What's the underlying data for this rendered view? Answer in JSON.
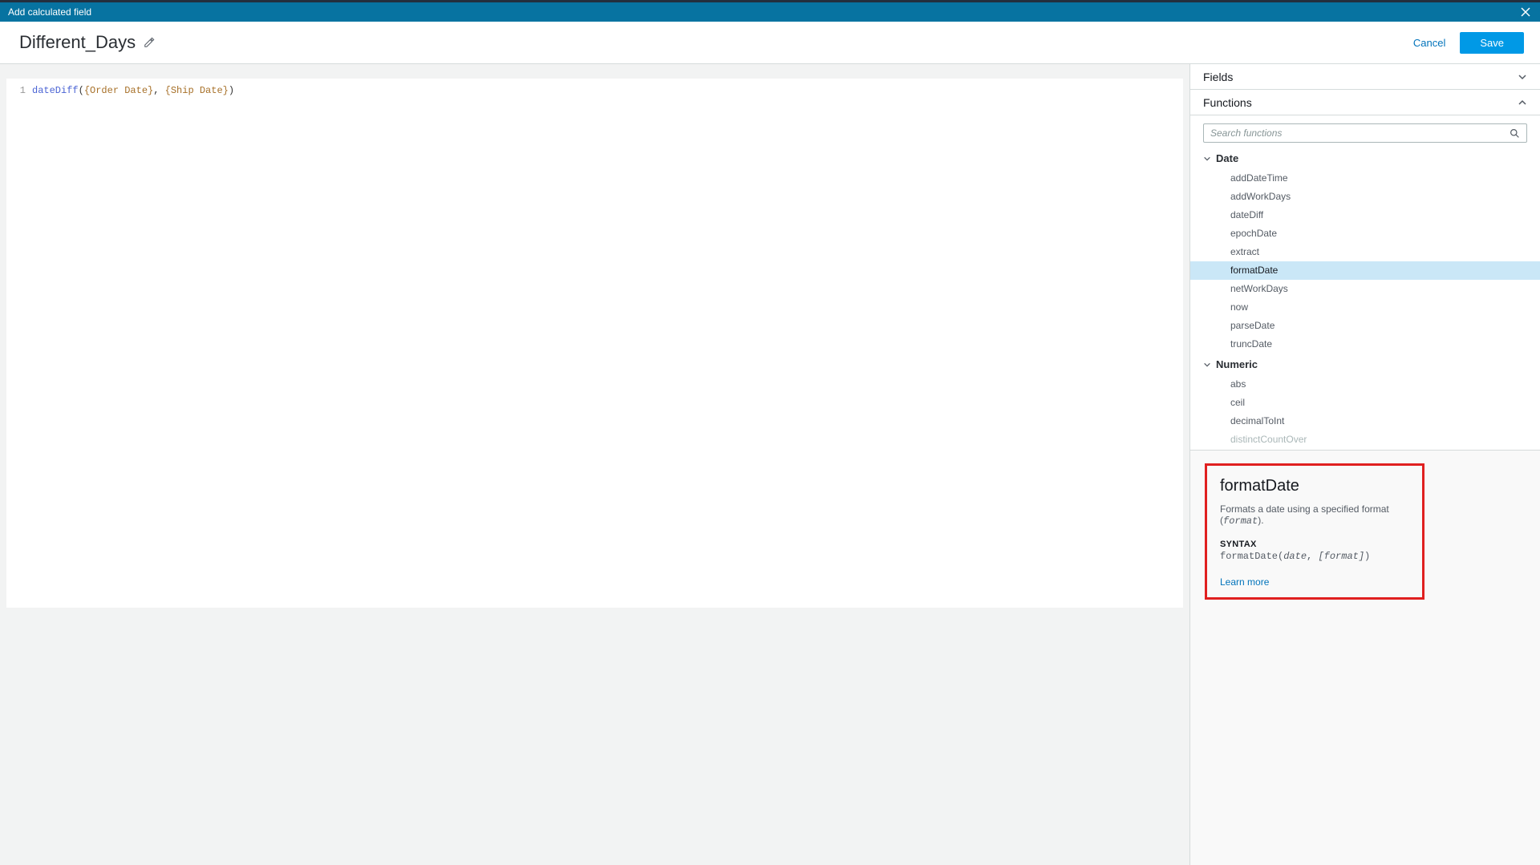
{
  "modal": {
    "title": "Add calculated field"
  },
  "toolbar": {
    "field_name": "Different_Days",
    "cancel_label": "Cancel",
    "save_label": "Save"
  },
  "editor": {
    "line_number": "1",
    "fn": "dateDiff",
    "open": "(",
    "field1": "{Order Date}",
    "comma": ", ",
    "field2": "{Ship Date}",
    "close": ")"
  },
  "panels": {
    "fields": {
      "title": "Fields"
    },
    "functions": {
      "title": "Functions",
      "search_placeholder": "Search functions"
    }
  },
  "function_categories": [
    {
      "name": "Date",
      "items": [
        {
          "label": "addDateTime",
          "selected": false
        },
        {
          "label": "addWorkDays",
          "selected": false
        },
        {
          "label": "dateDiff",
          "selected": false
        },
        {
          "label": "epochDate",
          "selected": false
        },
        {
          "label": "extract",
          "selected": false
        },
        {
          "label": "formatDate",
          "selected": true
        },
        {
          "label": "netWorkDays",
          "selected": false
        },
        {
          "label": "now",
          "selected": false
        },
        {
          "label": "parseDate",
          "selected": false
        },
        {
          "label": "truncDate",
          "selected": false
        }
      ]
    },
    {
      "name": "Numeric",
      "items": [
        {
          "label": "abs",
          "selected": false
        },
        {
          "label": "ceil",
          "selected": false
        },
        {
          "label": "decimalToInt",
          "selected": false
        },
        {
          "label": "distinctCountOver",
          "selected": false,
          "disabled": true
        }
      ]
    }
  ],
  "doc": {
    "title": "formatDate",
    "desc_prefix": "Formats a date using a specified format (",
    "desc_mono": "format",
    "desc_suffix": ").",
    "syntax_label": "SYNTAX",
    "syntax_fn": "formatDate(",
    "syntax_arg1": "date",
    "syntax_comma": ", ",
    "syntax_arg2": "[format]",
    "syntax_close": ")",
    "learn_more": "Learn more"
  }
}
